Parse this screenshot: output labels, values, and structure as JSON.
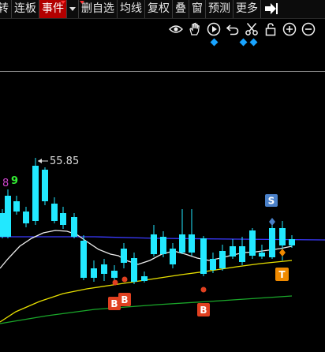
{
  "toolbar": {
    "items": [
      {
        "label": "转",
        "active": false,
        "partial": true
      },
      {
        "label": "连板",
        "active": false
      },
      {
        "label": "事件",
        "active": true
      },
      {
        "label": "删自选",
        "active": false
      },
      {
        "label": "均线",
        "active": false
      },
      {
        "label": "复权",
        "active": false
      },
      {
        "label": "叠",
        "active": false
      },
      {
        "label": "窗",
        "active": false
      },
      {
        "label": "预测",
        "active": false
      },
      {
        "label": "更多",
        "active": false
      }
    ],
    "icons": [
      "eye-icon",
      "hand-icon",
      "play-icon",
      "undo-icon",
      "scissors-icon",
      "lock-icon",
      "zoom-in-icon",
      "zoom-out-icon"
    ]
  },
  "chart": {
    "price_label": "55.85",
    "left_labels": [
      {
        "text": "8",
        "color": "#cc44cc"
      },
      {
        "text": "9",
        "color": "#33ee33"
      }
    ],
    "signals": [
      {
        "text": "S",
        "color": "#4a80c8"
      },
      {
        "text": "T",
        "color": "#f08a00"
      },
      {
        "text": "B",
        "color": "#e04020"
      },
      {
        "text": "B",
        "color": "#e04020"
      },
      {
        "text": "B",
        "color": "#e04020"
      }
    ],
    "colors": {
      "up": "#ff3b3b",
      "down": "#22e8ff",
      "ma_white": "#eeeeee",
      "ma_yellow": "#e8e000",
      "ma_green": "#1aa82a",
      "ma_blue": "#3a3aff"
    }
  }
}
